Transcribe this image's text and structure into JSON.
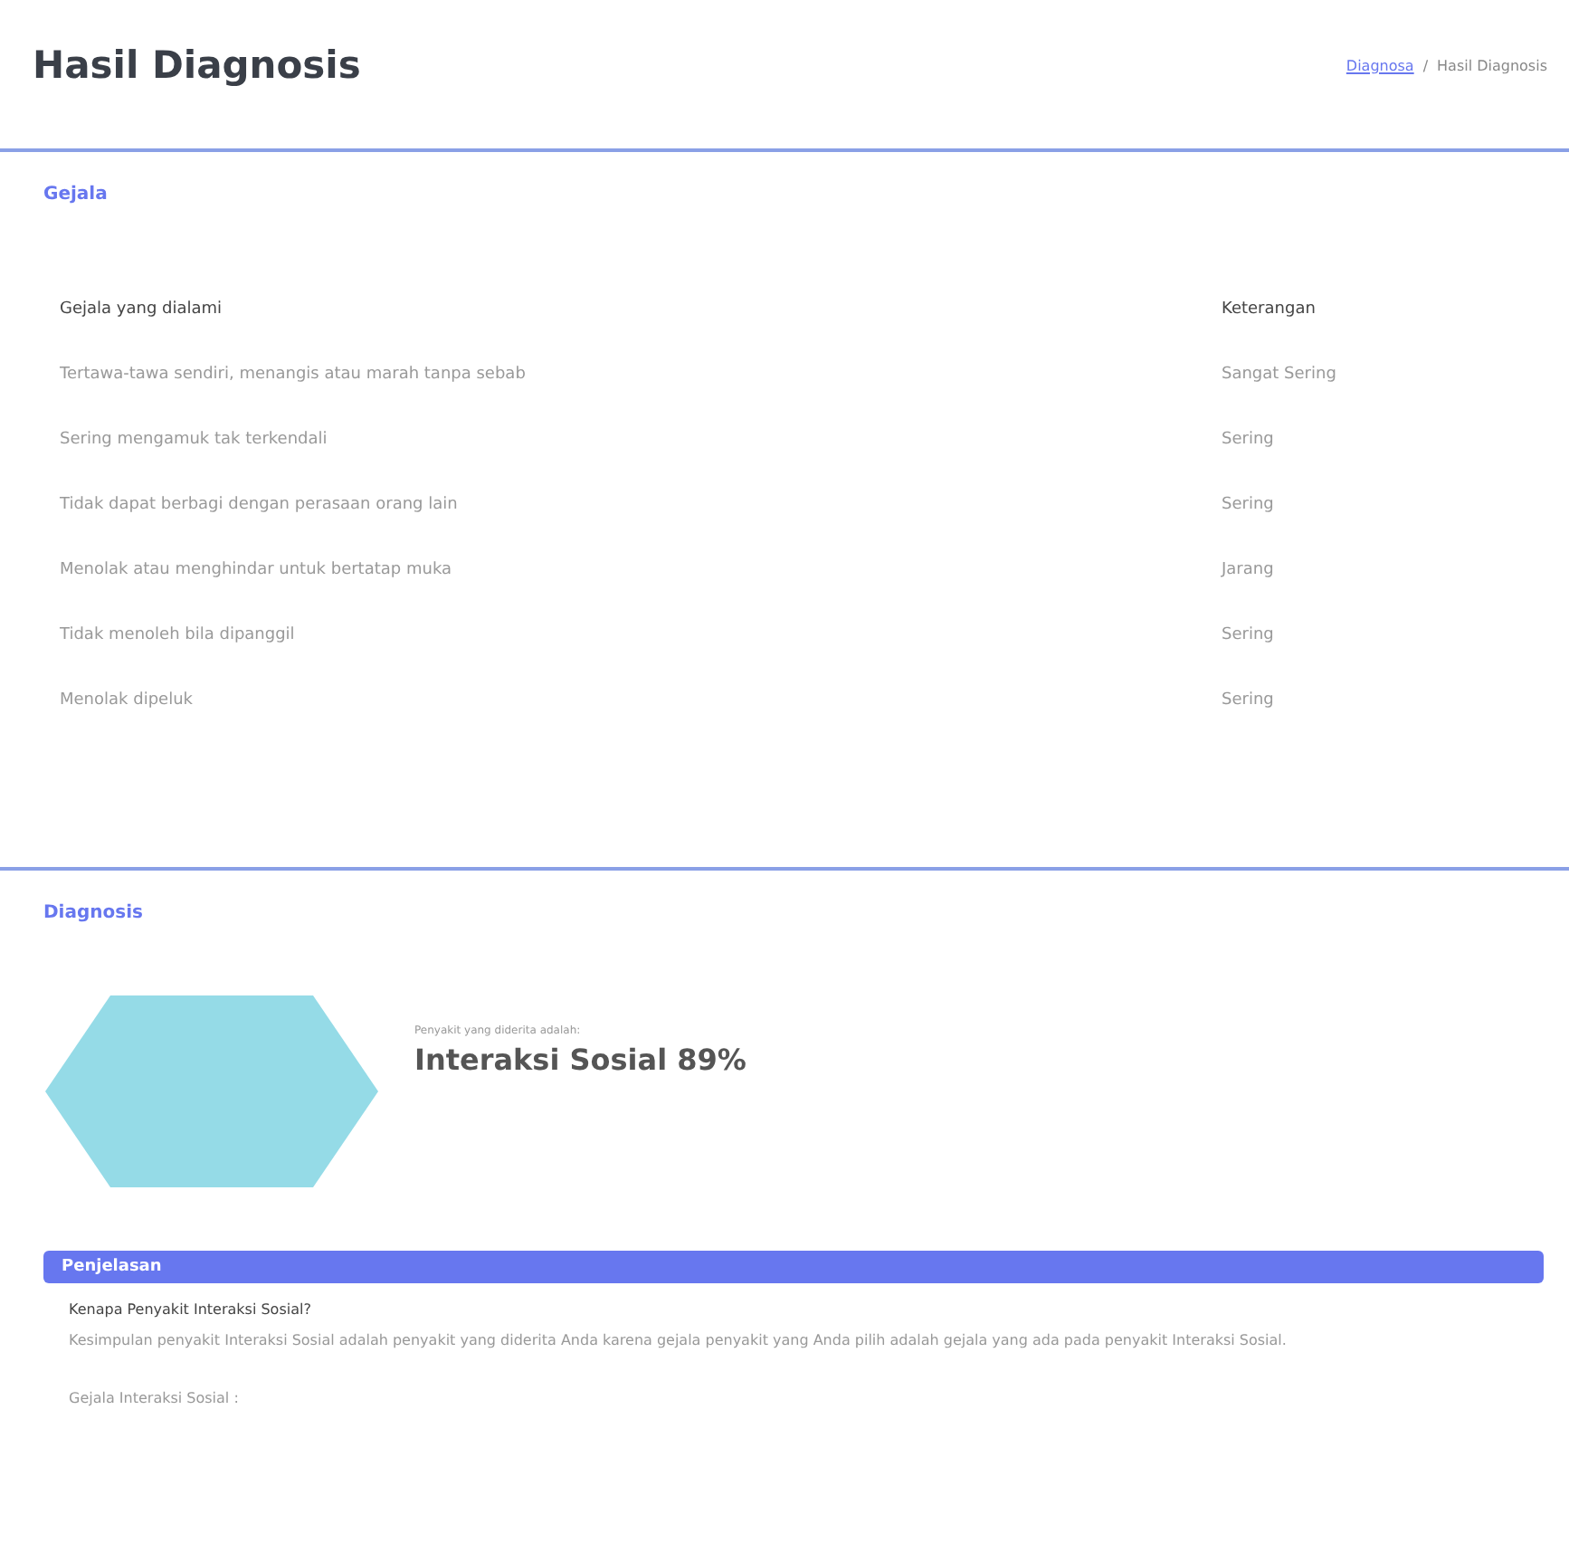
{
  "page_title": "Hasil Diagnosis",
  "breadcrumb": {
    "link": "Diagnosa",
    "separator": "/",
    "current": "Hasil Diagnosis"
  },
  "symptoms_card": {
    "title": "Gejala",
    "columns": [
      "Gejala yang dialami",
      "Keterangan"
    ],
    "rows": [
      {
        "symptom": "Tertawa-tawa sendiri, menangis atau marah tanpa sebab",
        "note": "Sangat Sering"
      },
      {
        "symptom": "Sering mengamuk tak terkendali",
        "note": "Sering"
      },
      {
        "symptom": "Tidak dapat berbagi dengan perasaan orang lain",
        "note": "Sering"
      },
      {
        "symptom": "Menolak atau menghindar untuk bertatap muka",
        "note": "Jarang"
      },
      {
        "symptom": "Tidak menoleh bila dipanggil",
        "note": "Sering"
      },
      {
        "symptom": "Menolak dipeluk",
        "note": "Sering"
      }
    ]
  },
  "diagnosis_card": {
    "title": "Diagnosis",
    "caption": "Penyakit yang diderita adalah:",
    "result": "Interaksi Sosial 89%",
    "explanation": {
      "header": "Penjelasan",
      "question": "Kenapa Penyakit Interaksi Sosial?",
      "answer": "Kesimpulan penyakit Interaksi Sosial adalah penyakit yang diderita Anda karena gejala penyakit yang Anda pilih adalah gejala yang ada pada penyakit Interaksi Sosial.",
      "list_title": "Gejala Interaksi Sosial :"
    }
  }
}
